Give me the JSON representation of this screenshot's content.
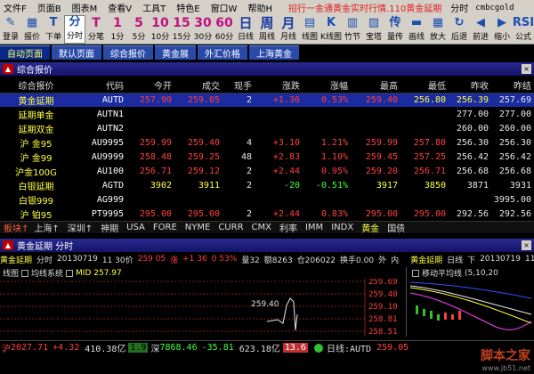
{
  "menu": {
    "items": [
      "文件F",
      "页面B",
      "图表M",
      "查看V",
      "工具T",
      "特色E",
      "窗口W",
      "帮助H"
    ],
    "notice": "招行一金通黄金实时行情.110黄金延期",
    "product": "分时",
    "user": "cmbcgold"
  },
  "toolbar": {
    "buttons": [
      {
        "icon": "✎",
        "label": "登录"
      },
      {
        "icon": "▦",
        "label": "报价"
      },
      {
        "icon": "T",
        "label": "下单"
      },
      {
        "icon": "分",
        "label": "分时",
        "active": true
      },
      {
        "icon": "T",
        "label": "分笔",
        "per": true
      },
      {
        "icon": "1",
        "label": "1分",
        "per": true
      },
      {
        "icon": "5",
        "label": "5分",
        "per": true
      },
      {
        "icon": "10",
        "label": "10分",
        "per": true
      },
      {
        "icon": "15",
        "label": "15分",
        "per": true
      },
      {
        "icon": "30",
        "label": "30分",
        "per": true
      },
      {
        "icon": "60",
        "label": "60分",
        "per": true
      },
      {
        "icon": "日",
        "label": "日线",
        "big": true
      },
      {
        "icon": "周",
        "label": "周线",
        "big": true
      },
      {
        "icon": "月",
        "label": "月线",
        "big": true
      },
      {
        "icon": "▤",
        "label": "线图"
      },
      {
        "icon": "K",
        "label": "K线图"
      },
      {
        "icon": "▥",
        "label": "竹节"
      },
      {
        "icon": "▨",
        "label": "宝塔"
      },
      {
        "icon": "传",
        "label": "量传"
      },
      {
        "icon": "▬",
        "label": "画线"
      },
      {
        "icon": "▦",
        "label": "放大"
      },
      {
        "icon": "↻",
        "label": "后退"
      },
      {
        "icon": "◀",
        "label": "前进"
      },
      {
        "icon": "▶",
        "label": "缩小"
      },
      {
        "icon": "RSI",
        "label": "公式"
      }
    ]
  },
  "pagetabs": [
    "自动页面",
    "默认页面",
    "综合报价",
    "黄金展",
    "外汇价格",
    "上海黄金"
  ],
  "quote_panel": {
    "title": "综合报价",
    "headers": [
      "综合报价",
      "代码",
      "今开",
      "成交",
      "现手",
      "涨跌",
      "涨幅",
      "最高",
      "最低",
      "昨收",
      "昨结"
    ],
    "rows": [
      {
        "name": "黄金延期",
        "code": "AUTD",
        "open": "257.90",
        "last": "259.05",
        "vol": "2",
        "chg": "+1.36",
        "pct": "0.53%",
        "high": "259.40",
        "low": "256.80",
        "pclose": "256.39",
        "psettle": "257.69",
        "dir": "up",
        "sel": true
      },
      {
        "name": "延期单金",
        "code": "AUTN1",
        "open": "",
        "last": "",
        "vol": "",
        "chg": "",
        "pct": "",
        "high": "",
        "low": "",
        "pclose": "277.00",
        "psettle": "277.00",
        "dir": "none"
      },
      {
        "name": "延期双金",
        "code": "AUTN2",
        "open": "",
        "last": "",
        "vol": "",
        "chg": "",
        "pct": "",
        "high": "",
        "low": "",
        "pclose": "260.00",
        "psettle": "260.00",
        "dir": "none"
      },
      {
        "name": "沪 金95",
        "code": "AU9995",
        "open": "259.99",
        "last": "259.40",
        "vol": "4",
        "chg": "+3.10",
        "pct": "1.21%",
        "high": "259.99",
        "low": "257.80",
        "pclose": "256.30",
        "psettle": "256.30",
        "dir": "up"
      },
      {
        "name": "沪 金99",
        "code": "AU9999",
        "open": "258.48",
        "last": "259.25",
        "vol": "48",
        "chg": "+2.83",
        "pct": "1.10%",
        "high": "259.45",
        "low": "257.25",
        "pclose": "256.42",
        "psettle": "256.42",
        "dir": "up"
      },
      {
        "name": "沪金100G",
        "code": "AU100",
        "open": "256.71",
        "last": "259.12",
        "vol": "2",
        "chg": "+2.44",
        "pct": "0.95%",
        "high": "259.20",
        "low": "256.71",
        "pclose": "256.68",
        "psettle": "256.68",
        "dir": "up"
      },
      {
        "name": "白银延期",
        "code": "AGTD",
        "open": "3902",
        "last": "3911",
        "vol": "2",
        "chg": "-20",
        "pct": "-0.51%",
        "high": "3917",
        "low": "3850",
        "pclose": "3871",
        "psettle": "3931",
        "dir": "dn"
      },
      {
        "name": "白银999",
        "code": "AG999",
        "open": "",
        "last": "",
        "vol": "",
        "chg": "",
        "pct": "",
        "high": "",
        "low": "",
        "pclose": "",
        "psettle": "3995.00",
        "dir": "none"
      },
      {
        "name": "沪 铂95",
        "code": "PT9995",
        "open": "295.00",
        "last": "295.00",
        "vol": "2",
        "chg": "+2.44",
        "pct": "0.83%",
        "high": "295.00",
        "low": "295.00",
        "pclose": "292.56",
        "psettle": "292.56",
        "dir": "up"
      },
      {
        "name": "现货黄金",
        "code": "XAU",
        "open": "1283.20",
        "last": "1283.00",
        "vol": "1",
        "chg": "-9.80",
        "pct": "-0.75%",
        "high": "1294.60",
        "low": "1281.20",
        "pclose": "1284.20",
        "psettle": "1292.80",
        "dir": "dn"
      }
    ]
  },
  "market_tabs": {
    "label": "板块↑",
    "items": [
      "上海↑",
      "深圳↑",
      "神期",
      "USA",
      "FORE",
      "NYME",
      "CURR",
      "CMX",
      "利率",
      "IMM",
      "INDX",
      "黄金",
      "国债"
    ]
  },
  "chart_panel": {
    "title": "黄金延期 分时",
    "info": [
      "黄金延期",
      "分时",
      "20130719",
      "11 30价",
      "259 05",
      "涨",
      "+1 36",
      "0 53%",
      "量32",
      "额8263",
      "仓206022",
      "换手0.00",
      "外",
      "内"
    ],
    "daily_info": [
      "黄金延期",
      "日线",
      "下",
      "20130719",
      "11"
    ],
    "intraday_head": [
      "线图",
      "均线系统",
      "MID 257.97"
    ],
    "daily_head": [
      "移动平均线",
      "(5,10,20"
    ],
    "price_label": "259.40",
    "axis_labels": [
      "259.69",
      "259.40",
      "259.10",
      "258.81",
      "258.51"
    ]
  },
  "status_bar": {
    "sh_label": "沪",
    "sh_index": "2027.71",
    "sh_chg": "+4.32",
    "sh_amt": "410.38亿",
    "sh_box": "1.9",
    "sz_label": "深",
    "sz_index": "7868.46",
    "sz_chg": "-35.81",
    "sz_amt": "623.18亿",
    "sz_box": "13.6",
    "quote": "日线:AUTD",
    "price": "259.05"
  },
  "watermark": {
    "text": "脚本之家",
    "sub": "www.jb51.net"
  },
  "colors": {
    "up": "#ff4040",
    "down": "#40ff40",
    "name": "#ffff40",
    "selected": "#1c2ca0"
  }
}
